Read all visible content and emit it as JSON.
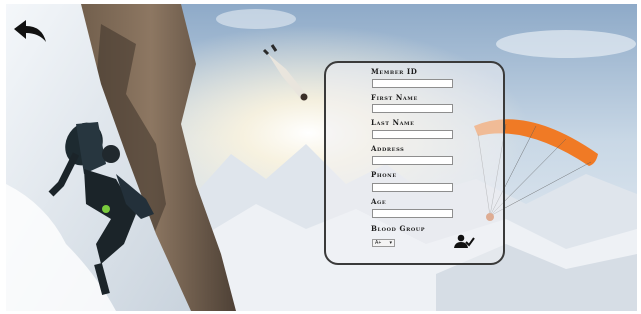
{
  "form": {
    "member_id": {
      "label": "Member ID",
      "value": "",
      "placeholder": ""
    },
    "first_name": {
      "label": "First Name",
      "value": "",
      "placeholder": ""
    },
    "last_name": {
      "label": "Last Name",
      "value": "",
      "placeholder": ""
    },
    "address": {
      "label": "Address",
      "value": "",
      "placeholder": ""
    },
    "phone": {
      "label": "Phone",
      "value": "",
      "placeholder": ""
    },
    "age": {
      "label": "Age",
      "value": "",
      "placeholder": ""
    },
    "blood_group": {
      "label": "Blood Group",
      "selected": "A+"
    }
  },
  "icons": {
    "back": "arrow-left-icon",
    "submit": "user-check-icon"
  },
  "colors": {
    "panel_border": "#3a3a3a",
    "field_border": "#8e8e8e",
    "parachute": "#f07a25",
    "sky": "#b9cfe3"
  }
}
